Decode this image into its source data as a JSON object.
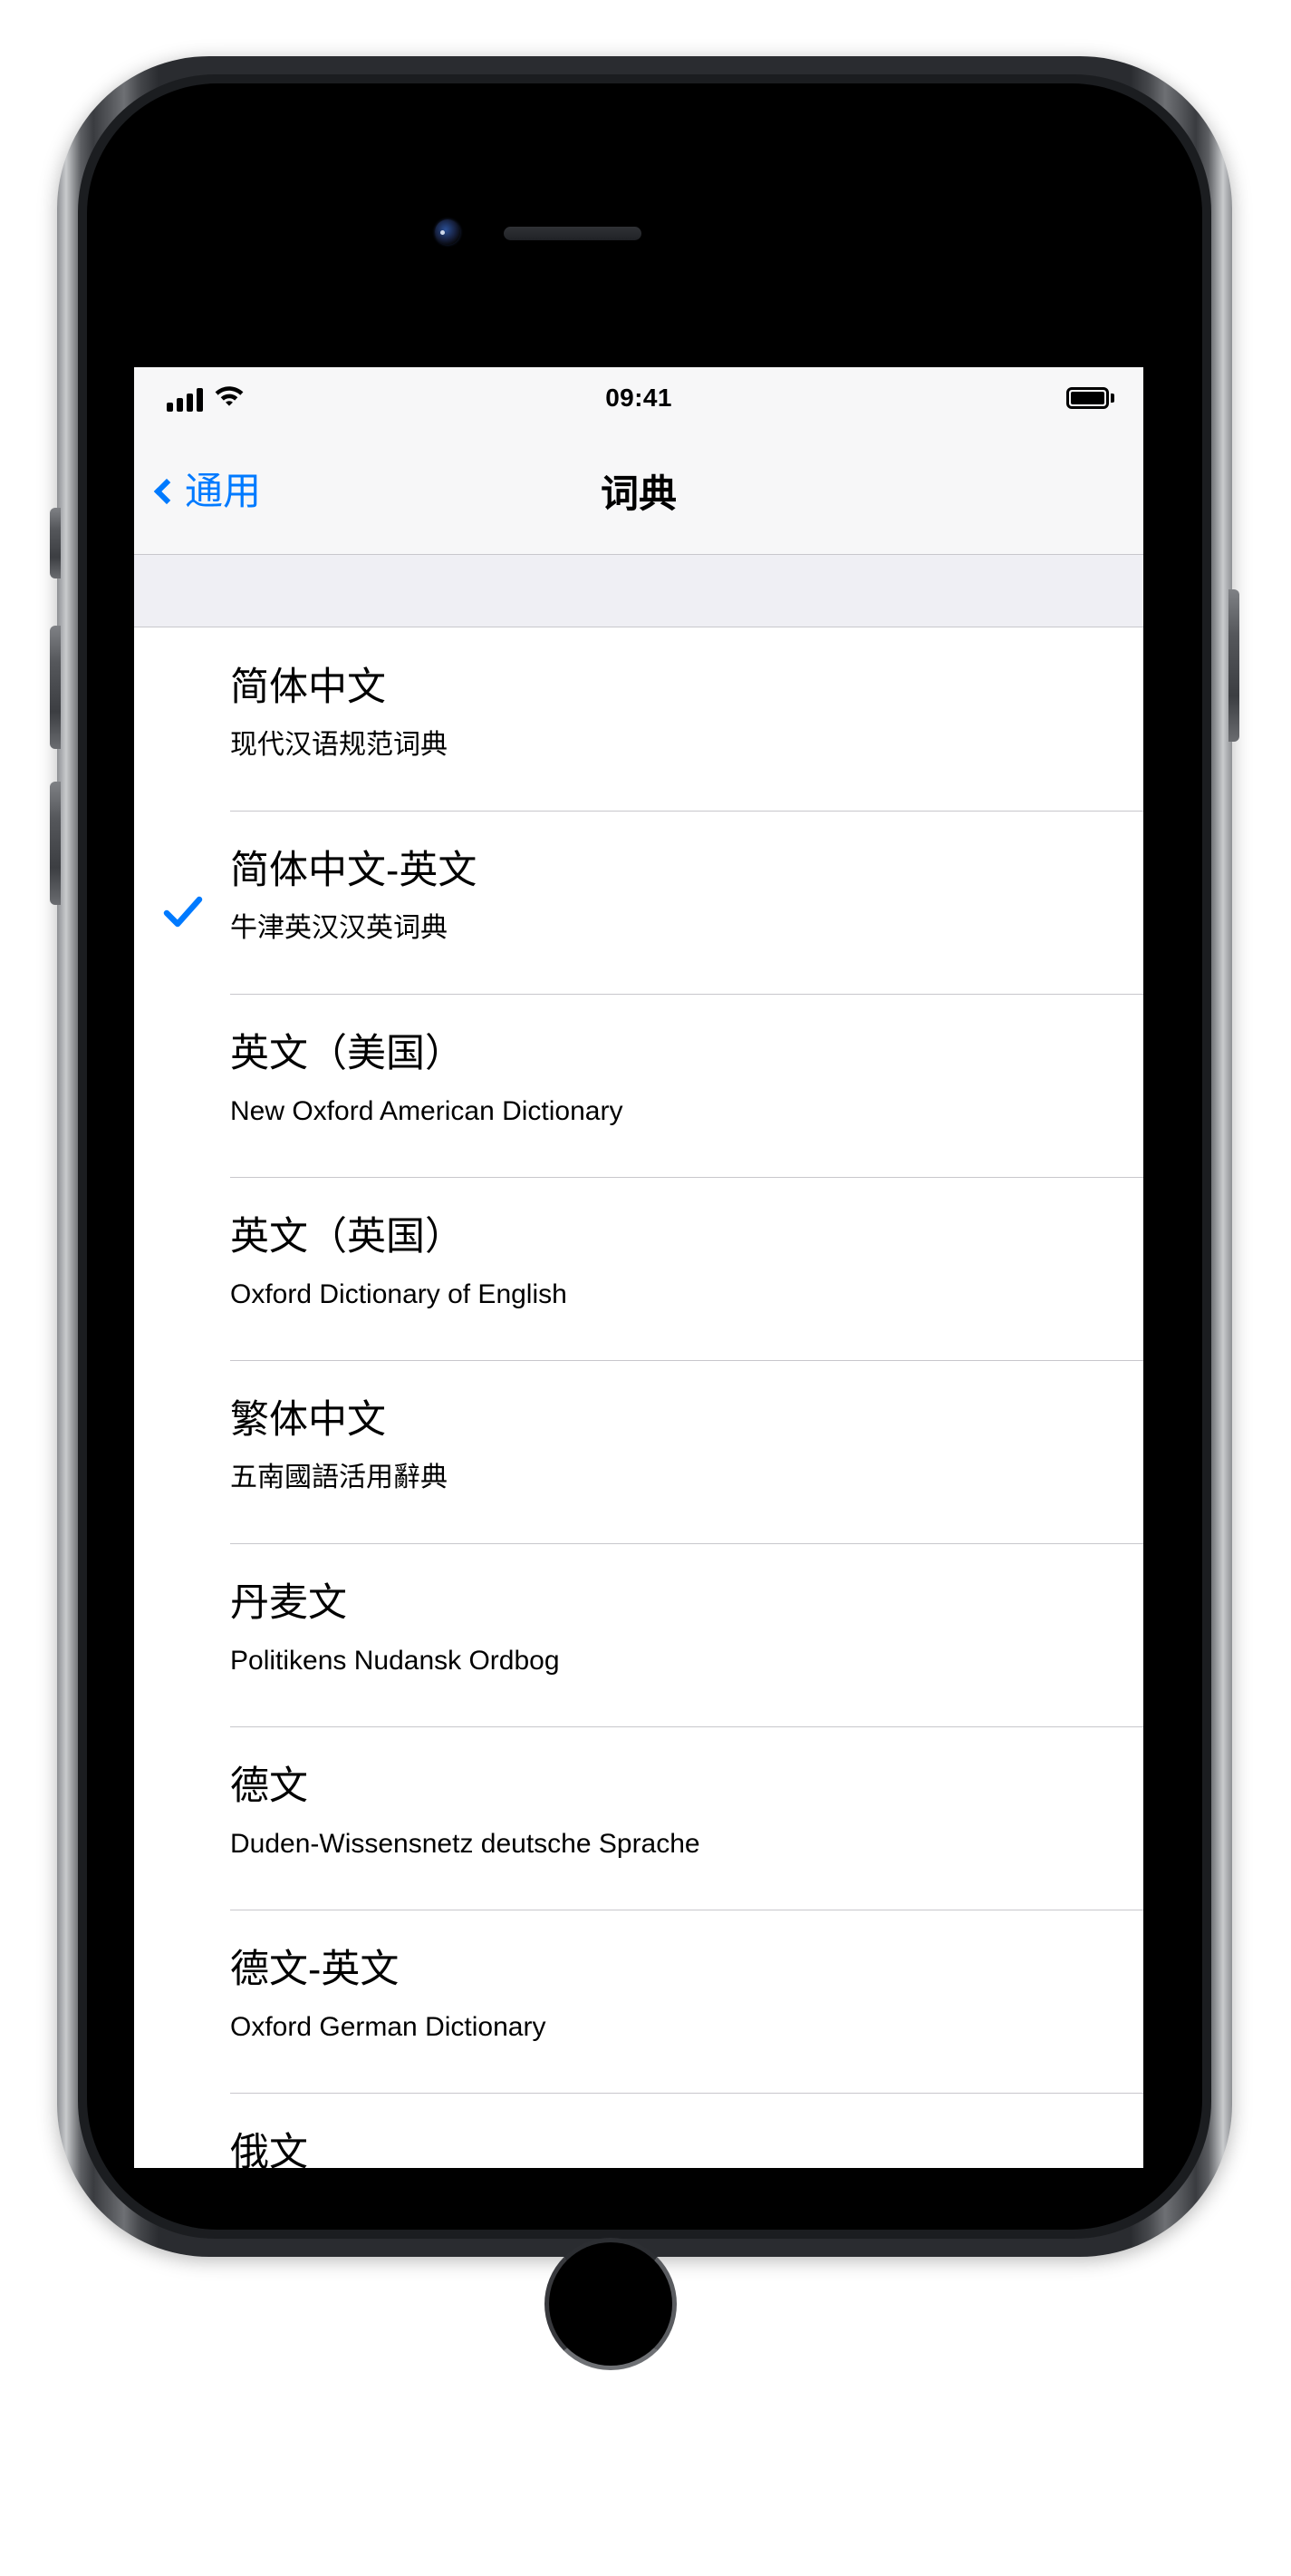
{
  "device": {
    "model_style": "iphone-space-gray",
    "icons": {
      "front_camera": "front-camera-icon",
      "earpiece": "earpiece-speaker-icon",
      "home_button": "home-button"
    }
  },
  "status_bar": {
    "signal_icon": "cellular-signal-icon",
    "signal_bars": 4,
    "wifi_icon": "wifi-icon",
    "time": "09:41",
    "battery_icon": "battery-full-icon"
  },
  "nav_bar": {
    "back_icon": "chevron-left-icon",
    "back_label": "通用",
    "title": "词典",
    "accent_color": "#007aff"
  },
  "list": {
    "check_icon": "checkmark-icon",
    "check_color": "#007aff",
    "rows": [
      {
        "title": "简体中文",
        "subtitle": "现代汉语规范词典",
        "selected": false
      },
      {
        "title": "简体中文-英文",
        "subtitle": "牛津英汉汉英词典",
        "selected": true
      },
      {
        "title": "英文（美国）",
        "subtitle": "New Oxford American Dictionary",
        "selected": false
      },
      {
        "title": "英文（英国）",
        "subtitle": "Oxford Dictionary of English",
        "selected": false
      },
      {
        "title": "繁体中文",
        "subtitle": "五南國語活用辭典",
        "selected": false
      },
      {
        "title": "丹麦文",
        "subtitle": "Politikens Nudansk Ordbog",
        "selected": false
      },
      {
        "title": "德文",
        "subtitle": "Duden-Wissensnetz deutsche Sprache",
        "selected": false
      },
      {
        "title": "德文-英文",
        "subtitle": "Oxford German Dictionary",
        "selected": false
      },
      {
        "title": "俄文",
        "subtitle": "",
        "selected": false
      }
    ]
  }
}
